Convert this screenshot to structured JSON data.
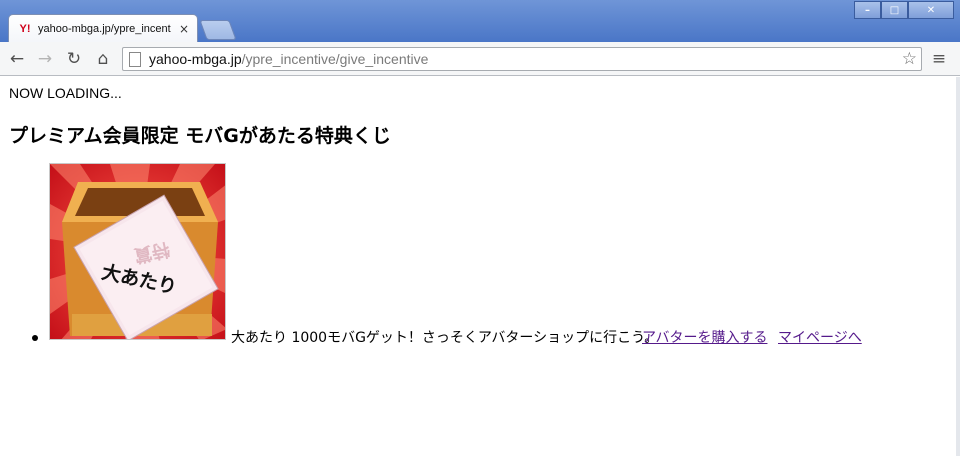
{
  "browser": {
    "tab": {
      "favicon_text": "Y!",
      "title": "yahoo-mbga.jp/ypre_incent",
      "close_glyph": "×"
    },
    "window_controls": {
      "minimize_glyph": "–",
      "maximize_glyph": "□",
      "close_glyph": "✕"
    },
    "toolbar": {
      "back_glyph": "←",
      "forward_glyph": "→",
      "reload_glyph": "↻",
      "home_glyph": "⌂",
      "menu_glyph": "≡",
      "star_glyph": "☆"
    },
    "address": {
      "host": "yahoo-mbga.jp",
      "path": "/ypre_incentive/give_incentive"
    }
  },
  "page": {
    "loading_text": "NOW LOADING...",
    "heading": "プレミアム会員限定 モバGがあたる特典くじ",
    "prize": {
      "image_caption": "大あたり",
      "description": "大あたり 1000モバGゲット！さっそくアバターショップに行こう。",
      "links": [
        {
          "label": "アバターを購入する"
        },
        {
          "label": "マイページへ"
        }
      ]
    }
  },
  "colors": {
    "titlebar": "#5b83cf",
    "link_visited": "#551a8b",
    "image_red": "#d4151b"
  }
}
